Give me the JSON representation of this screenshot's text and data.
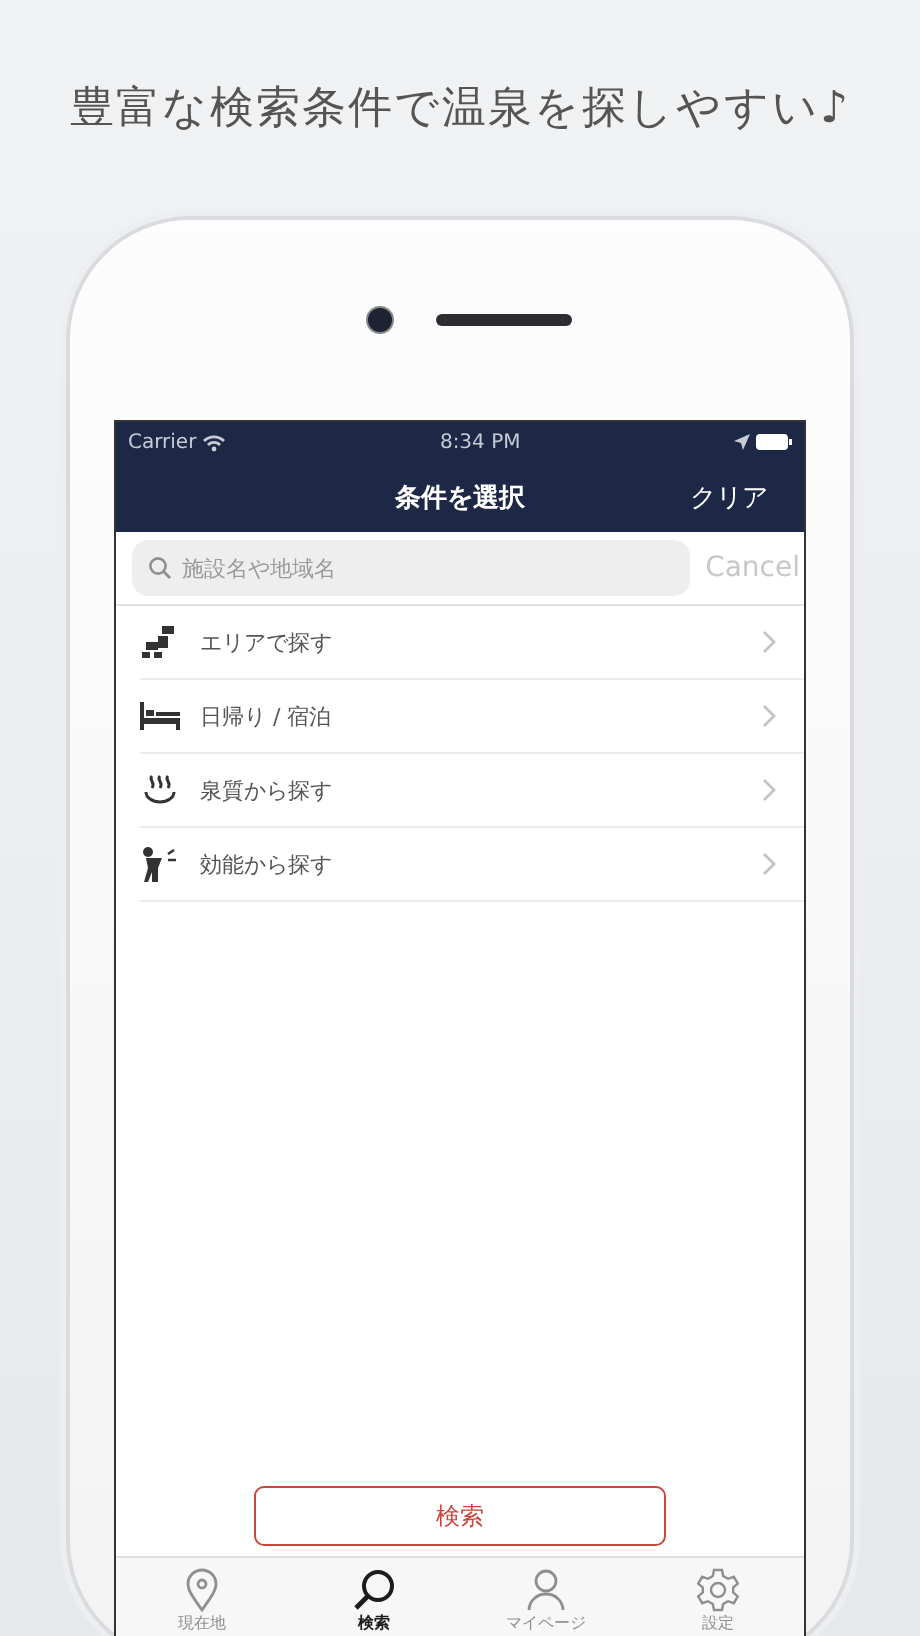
{
  "headline": "豊富な検索条件で温泉を探しやすい♪",
  "status_bar": {
    "carrier": "Carrier",
    "time": "8:34 PM"
  },
  "nav_bar": {
    "title": "条件を選択",
    "action": "クリア"
  },
  "search": {
    "placeholder": "施設名や地域名",
    "cancel": "Cancel"
  },
  "menu": [
    {
      "label": "エリアで探す",
      "kind": "area"
    },
    {
      "label": "日帰り / 宿泊",
      "kind": "stay"
    },
    {
      "label": "泉質から探す",
      "kind": "spring"
    },
    {
      "label": "効能から探す",
      "kind": "effect"
    }
  ],
  "search_button": "検索",
  "tabs": [
    {
      "label": "現在地",
      "kind": "location",
      "selected": false
    },
    {
      "label": "検索",
      "kind": "search",
      "selected": true
    },
    {
      "label": "マイページ",
      "kind": "person",
      "selected": false
    },
    {
      "label": "設定",
      "kind": "gear",
      "selected": false
    }
  ]
}
